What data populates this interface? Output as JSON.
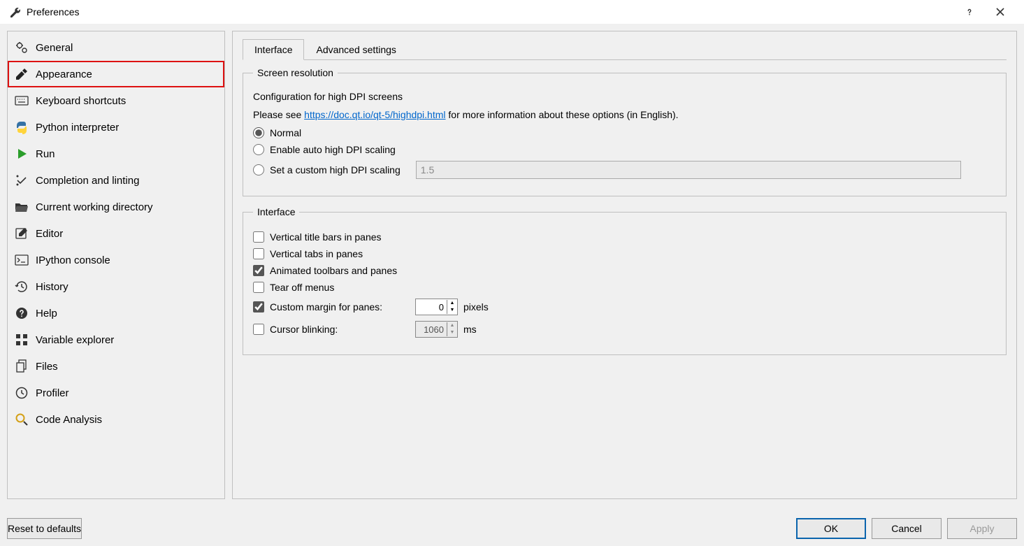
{
  "window": {
    "title": "Preferences"
  },
  "sidebar": {
    "items": [
      {
        "label": "General"
      },
      {
        "label": "Appearance"
      },
      {
        "label": "Keyboard shortcuts"
      },
      {
        "label": "Python interpreter"
      },
      {
        "label": "Run"
      },
      {
        "label": "Completion and linting"
      },
      {
        "label": "Current working directory"
      },
      {
        "label": "Editor"
      },
      {
        "label": "IPython console"
      },
      {
        "label": "History"
      },
      {
        "label": "Help"
      },
      {
        "label": "Variable explorer"
      },
      {
        "label": "Files"
      },
      {
        "label": "Profiler"
      },
      {
        "label": "Code Analysis"
      }
    ]
  },
  "tabs": {
    "interface": "Interface",
    "advanced": "Advanced settings"
  },
  "screen_resolution": {
    "legend": "Screen resolution",
    "subtitle": "Configuration for high DPI screens",
    "see_prefix": "Please see ",
    "see_link": "https://doc.qt.io/qt-5/highdpi.html",
    "see_suffix": " for more information about these options (in English).",
    "radio_normal": "Normal",
    "radio_auto": "Enable auto high DPI scaling",
    "radio_custom": "Set a custom high DPI scaling",
    "custom_value": "1.5"
  },
  "interface": {
    "legend": "Interface",
    "vertical_title_bars": "Vertical title bars in panes",
    "vertical_tabs": "Vertical tabs in panes",
    "animated": "Animated toolbars and panes",
    "tear_off": "Tear off menus",
    "custom_margin": "Custom margin for panes:",
    "custom_margin_value": "0",
    "pixels": "pixels",
    "cursor_blinking": "Cursor blinking:",
    "cursor_blinking_value": "1060",
    "ms": "ms"
  },
  "buttons": {
    "reset": "Reset to defaults",
    "ok": "OK",
    "cancel": "Cancel",
    "apply": "Apply"
  }
}
